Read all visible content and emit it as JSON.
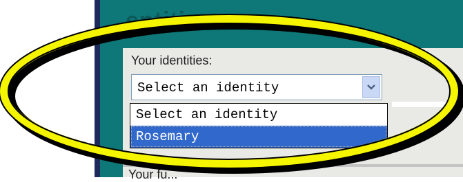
{
  "panel": {
    "heading": "entities",
    "field_label": "Your identities:",
    "bottom_label": "Your fu..."
  },
  "identity_select": {
    "value": "Select an identity",
    "options": [
      {
        "label": "Select an identity",
        "selected": false
      },
      {
        "label": "Rosemary",
        "selected": true
      }
    ],
    "arrow_icon": "chevron-down-icon"
  },
  "colors": {
    "panel_teal": "#0e7777",
    "highlight_yellow": "#f5f500",
    "selection_blue": "#3168cc"
  },
  "annotation": {
    "shape": "ellipse",
    "color": "yellow"
  }
}
